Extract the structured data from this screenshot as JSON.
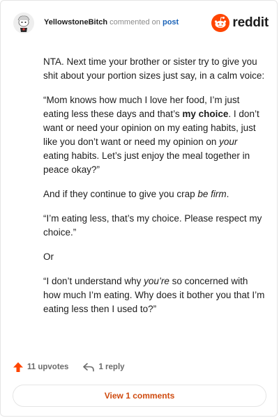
{
  "header": {
    "username": "YellowstoneBitch",
    "action_text": "commented on",
    "post_link": "post",
    "logo_text": "reddit"
  },
  "comment": {
    "p1": "NTA. Next time your brother or sister try to give you shit about your portion sizes just say, in a calm voice:",
    "p2_a": "“Mom knows how much I love her food, I’m just eating less these days and that’s ",
    "p2_b": "my choice",
    "p2_c": ". I don’t want or need your opinion on my eating habits, just like you don’t want or need my opinion on ",
    "p2_d": "your",
    "p2_e": " eating habits. Let’s just enjoy the meal together in peace okay?”",
    "p3_a": "And if they continue to give you crap ",
    "p3_b": "be firm",
    "p3_c": ".",
    "p4": "“I’m eating less, that’s my choice. Please respect my choice.”",
    "p5": "Or",
    "p6_a": "“I don’t understand why ",
    "p6_b": "you’re",
    "p6_c": " so concerned with how much I’m eating. Why does it bother you that I’m eating less then I used to?”"
  },
  "footer": {
    "upvotes": "11 upvotes",
    "replies": "1 reply",
    "view_comments": "View 1 comments"
  },
  "icons": {
    "upvote": "upvote-arrow-icon",
    "reply": "reply-arrow-icon",
    "avatar": "snoo-avatar",
    "logo": "reddit-snoo-logo"
  },
  "colors": {
    "brand": "#ff4500",
    "link": "#1a63b8",
    "view_button_text": "#cf4a0e",
    "text": "#1c1c1c",
    "muted": "#6b6b6b"
  }
}
